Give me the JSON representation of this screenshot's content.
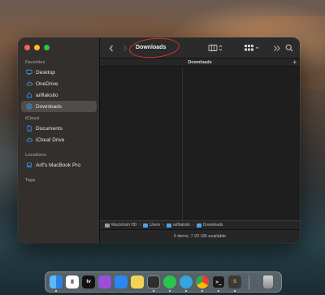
{
  "window": {
    "title": "Downloads",
    "tab_title": "Downloads",
    "status": "0 items, 7.92 GB available"
  },
  "sidebar": {
    "favorites_heading": "Favorites",
    "favorites": [
      {
        "label": "Desktop",
        "icon": "desktop-icon"
      },
      {
        "label": "OneDrive",
        "icon": "cloud-icon"
      },
      {
        "label": "ariflaksito",
        "icon": "home-icon"
      },
      {
        "label": "Downloads",
        "icon": "download-icon",
        "selected": true
      }
    ],
    "icloud_heading": "iCloud",
    "icloud": [
      {
        "label": "Documents",
        "icon": "document-icon"
      },
      {
        "label": "iCloud Drive",
        "icon": "icloud-icon"
      }
    ],
    "locations_heading": "Locations",
    "locations": [
      {
        "label": "Arif's MacBook Pro",
        "icon": "laptop-icon"
      }
    ],
    "tags_heading": "Tags"
  },
  "path": [
    "Macintosh HD",
    "Users",
    "ariflaksito",
    "Downloads"
  ],
  "colors": {
    "accent": "#3b9cff",
    "annotation": "#e0302a",
    "close": "#fe5f57",
    "minimize": "#febc2e",
    "zoom": "#28c840"
  },
  "dock": [
    {
      "name": "finder",
      "label": ""
    },
    {
      "name": "calendar",
      "label": "8"
    },
    {
      "name": "apple-tv",
      "label": "tv"
    },
    {
      "name": "podcasts",
      "label": ""
    },
    {
      "name": "safari",
      "label": ""
    },
    {
      "name": "notes",
      "label": ""
    },
    {
      "name": "chatgpt",
      "label": ""
    },
    {
      "name": "whatsapp",
      "label": ""
    },
    {
      "name": "telegram",
      "label": ""
    },
    {
      "name": "chrome",
      "label": ""
    },
    {
      "name": "terminal",
      "label": ">_"
    },
    {
      "name": "sublime-text",
      "label": "S"
    },
    {
      "name": "trash",
      "label": ""
    }
  ]
}
